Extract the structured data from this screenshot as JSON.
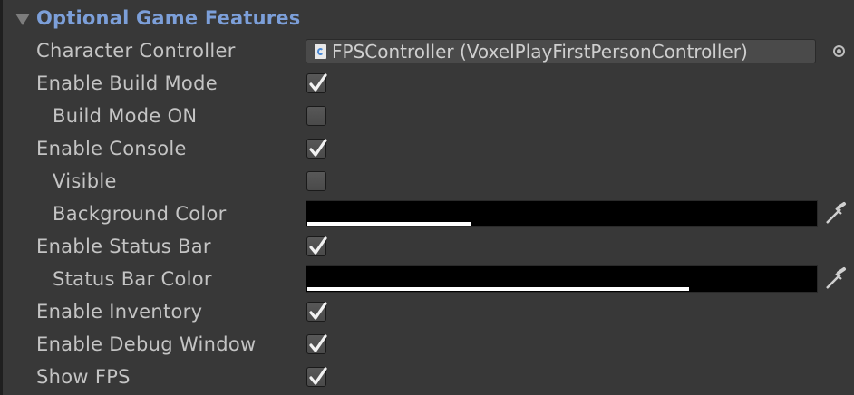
{
  "section": {
    "title": "Optional Game Features",
    "expanded": true
  },
  "fields": {
    "character_controller": {
      "label": "Character Controller",
      "value": "FPSController (VoxelPlayFirstPersonController)",
      "icon": "csharp-script-icon"
    },
    "enable_build_mode": {
      "label": "Enable Build Mode",
      "checked": true
    },
    "build_mode_on": {
      "label": "Build Mode ON",
      "checked": false
    },
    "enable_console": {
      "label": "Enable Console",
      "checked": true
    },
    "visible": {
      "label": "Visible",
      "checked": false
    },
    "background_color": {
      "label": "Background Color",
      "color": "#000000",
      "alpha": 0.32
    },
    "enable_status_bar": {
      "label": "Enable Status Bar",
      "checked": true
    },
    "status_bar_color": {
      "label": "Status Bar Color",
      "color": "#000000",
      "alpha": 0.75
    },
    "enable_inventory": {
      "label": "Enable Inventory",
      "checked": true
    },
    "enable_debug_window": {
      "label": "Enable Debug Window",
      "checked": true
    },
    "show_fps": {
      "label": "Show FPS",
      "checked": true
    }
  },
  "colors": {
    "panel_bg": "#383838",
    "header_text": "#7c9fd9",
    "label_text": "#c4c4c4"
  }
}
